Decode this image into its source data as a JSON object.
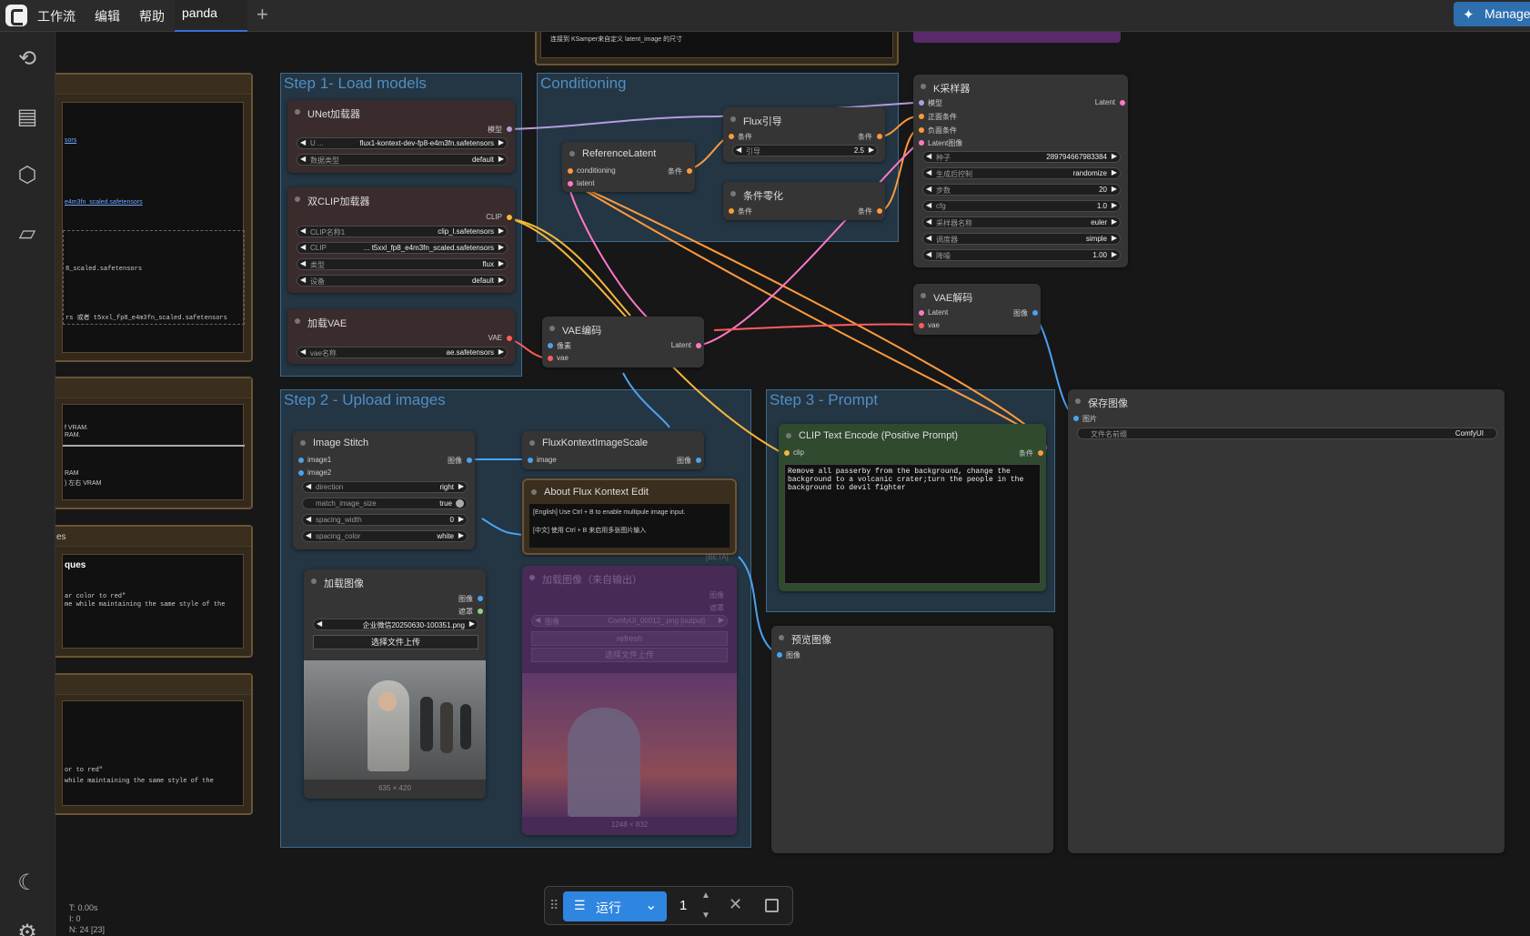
{
  "menu": {
    "workflow": "工作流",
    "edit": "编辑",
    "help": "帮助",
    "tab": "panda",
    "plus": "+",
    "manager": "Manager"
  },
  "stats": {
    "t": "T: 0.00s",
    "i": "I: 0",
    "n": "N: 24 [23]"
  },
  "groups": {
    "g1": "Step 1- Load models",
    "g2": "Conditioning",
    "g3": "Step 2 - Upload images",
    "g4": "Step 3 - Prompt"
  },
  "top_note": "连接到 KSamper来自定义 latent_image 的尺寸",
  "left_notes": {
    "link": "sors",
    "f1": "e4m3fn_scaled.safetensors",
    "f2": "8_scaled.safetensors",
    "f3": "rs 或者 t5xxl_fp8_e4m3fn_scaled.safetensors",
    "v1": "f VRAM.",
    "v2": "RAM.",
    "v3": "RAM",
    "v4": ") 左右 VRAM",
    "es": "es",
    "ques": "ques",
    "c1": "ar color to red\"",
    "c2": "me while maintaining the same style of the",
    "c3": "or to red\"",
    "c4": "while maintaining the same style of the"
  },
  "unet": {
    "title": "UNet加载器",
    "out": "模型",
    "w1l": "U ...",
    "w1v": "flux1-kontext-dev-fp8-e4m3fn.safetensors",
    "w2l": "数据类型",
    "w2v": "default"
  },
  "clip": {
    "title": "双CLIP加载器",
    "out": "CLIP",
    "w1l": "CLIP名称1",
    "w1v": "clip_l.safetensors",
    "w2l": "CLIP",
    "w2v": "... t5xxl_fp8_e4m3fn_scaled.safetensors",
    "w3l": "类型",
    "w3v": "flux",
    "w4l": "设备",
    "w4v": "default"
  },
  "vae": {
    "title": "加载VAE",
    "out": "VAE",
    "w1l": "vae名称",
    "w1v": "ae.safetensors"
  },
  "flux": {
    "title": "Flux引导",
    "in": "条件",
    "out": "条件",
    "wl": "引导",
    "wv": "2.5"
  },
  "ref": {
    "title": "ReferenceLatent",
    "in1": "conditioning",
    "in2": "latent",
    "out": "条件"
  },
  "zero": {
    "title": "条件零化",
    "in": "条件",
    "out": "条件"
  },
  "ks": {
    "title": "K采样器",
    "i1": "模型",
    "i2": "正面条件",
    "i3": "负面条件",
    "i4": "Latent图像",
    "out": "Latent",
    "w": [
      [
        "种子",
        "289794667983384"
      ],
      [
        "生成后控制",
        "randomize"
      ],
      [
        "步数",
        "20"
      ],
      [
        "cfg",
        "1.0"
      ],
      [
        "采样器名称",
        "euler"
      ],
      [
        "调度器",
        "simple"
      ],
      [
        "降噪",
        "1.00"
      ]
    ]
  },
  "vaed": {
    "title": "VAE解码",
    "i1": "Latent",
    "i2": "vae",
    "out": "图像"
  },
  "vaee": {
    "title": "VAE编码",
    "i1": "像素",
    "i2": "vae",
    "out": "Latent"
  },
  "save": {
    "title": "保存图像",
    "in": "图片",
    "wl": "文件名前缀",
    "wv": "ComfyUI"
  },
  "stitch": {
    "title": "Image Stitch",
    "i1": "image1",
    "i2": "image2",
    "out": "图像",
    "w": [
      [
        "direction",
        "right"
      ],
      [
        "match_image_size",
        "true"
      ],
      [
        "spacing_width",
        "0"
      ],
      [
        "spacing_color",
        "white"
      ]
    ]
  },
  "scale": {
    "title": "FluxKontextImageScale",
    "in": "image",
    "out": "图像"
  },
  "about": {
    "title": "About Flux Kontext Edit",
    "en": "[English] Use Ctrl + B to enable multipule image input.",
    "cn": "[中文] 使用 Ctrl + B 来启用多张图片输入",
    "beta": "[BETA]"
  },
  "load": {
    "title": "加载图像",
    "o1": "图像",
    "o2": "遮罩",
    "wv": "企业微信20250630-100351.png",
    "btn": "选择文件上传",
    "size": "635 × 420"
  },
  "load2": {
    "title": "加载图像（来自输出）",
    "o1": "图像",
    "o2": "遮罩",
    "wl": "图像",
    "wv": "ComfyUI_00012_.png [output]",
    "refresh": "refresh",
    "btn": "选择文件上传",
    "size": "1248 × 832"
  },
  "clipenc": {
    "title": "CLIP Text Encode (Positive Prompt)",
    "in": "clip",
    "out": "条件",
    "text": "Remove all passerby from the background, change the background to a volcanic crater;turn the people in the background to devil fighter"
  },
  "preview": {
    "title": "预览图像",
    "in": "图像"
  },
  "run": {
    "label": "运行",
    "count": "1"
  },
  "colors": {
    "accent": "#2f86e0",
    "group": "#4f8fc4",
    "link_clip": "#f5b73b",
    "link_model": "#b39ddb",
    "link_cond": "#ff9a3c",
    "link_latent": "#ff79c6",
    "link_vae": "#ff5c5c",
    "link_image": "#4aa3f0"
  }
}
